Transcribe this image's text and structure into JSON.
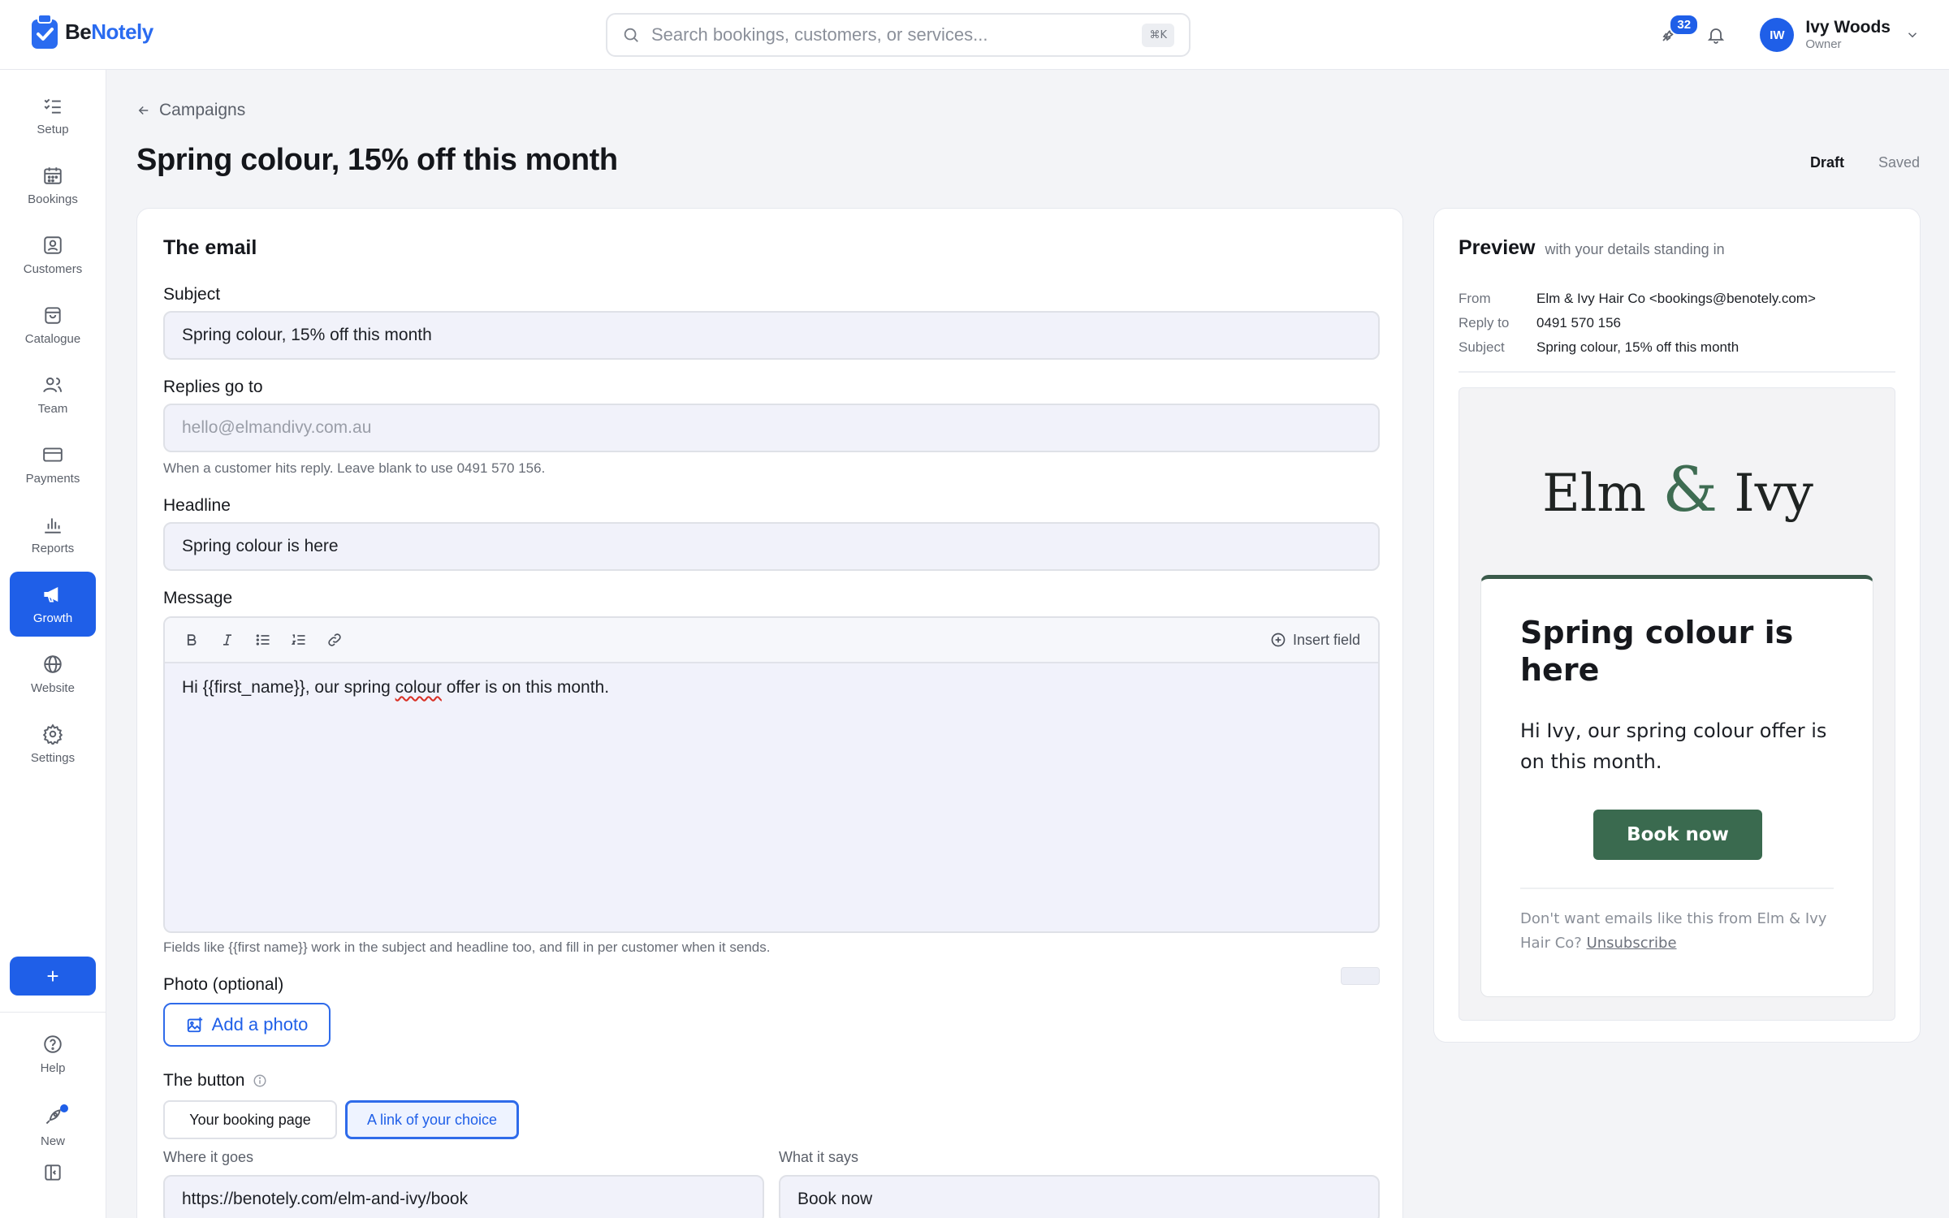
{
  "brand": {
    "name_a": "Be",
    "name_b": "Notely"
  },
  "search": {
    "placeholder": "Search bookings, customers, or services...",
    "shortcut": "⌘K"
  },
  "topbar": {
    "notifications_count": "32"
  },
  "user": {
    "initials": "IW",
    "name": "Ivy Woods",
    "role": "Owner"
  },
  "sidebar": {
    "items": [
      {
        "label": "Setup",
        "icon": "checklist-icon"
      },
      {
        "label": "Bookings",
        "icon": "calendar-icon"
      },
      {
        "label": "Customers",
        "icon": "contact-card-icon"
      },
      {
        "label": "Catalogue",
        "icon": "shopping-bag-icon"
      },
      {
        "label": "Team",
        "icon": "users-icon"
      },
      {
        "label": "Payments",
        "icon": "credit-card-icon"
      },
      {
        "label": "Reports",
        "icon": "bar-chart-icon"
      },
      {
        "label": "Growth",
        "icon": "megaphone-icon",
        "active": true
      },
      {
        "label": "Website",
        "icon": "globe-icon"
      },
      {
        "label": "Settings",
        "icon": "gear-icon"
      }
    ],
    "add_label": "+",
    "help_label": "Help",
    "new_label": "New"
  },
  "page": {
    "back_label": "Campaigns",
    "title": "Spring colour, 15% off this month",
    "status_draft": "Draft",
    "status_saved": "Saved"
  },
  "form": {
    "section_title": "The email",
    "subject_label": "Subject",
    "subject_value": "Spring colour, 15% off this month",
    "replies_label": "Replies go to",
    "replies_placeholder": "hello@elmandivy.com.au",
    "replies_hint": "When a customer hits reply. Leave blank to use 0491 570 156.",
    "headline_label": "Headline",
    "headline_value": "Spring colour is here",
    "message_label": "Message",
    "insert_field_label": "Insert field",
    "message_pre": "Hi {{first_name}}, our spring ",
    "message_misspelled": "colour",
    "message_post": " offer is on this month.",
    "fields_hint": "Fields like {{first name}} work in the subject and headline too, and fill in per customer when it sends.",
    "photo_label": "Photo (optional)",
    "photo_button": "Add a photo",
    "button_label": "The button",
    "button_option_1": "Your booking page",
    "button_option_2": "A link of your choice",
    "where_label": "Where it goes",
    "where_value": "https://benotely.com/elm-and-ivy/book",
    "says_label": "What it says",
    "says_value": "Book now"
  },
  "preview": {
    "title": "Preview",
    "subtitle": "with your details standing in",
    "from_key": "From",
    "from_value": "Elm & Ivy Hair Co <bookings@benotely.com>",
    "reply_key": "Reply to",
    "reply_value": "0491 570 156",
    "subject_key": "Subject",
    "subject_value": "Spring colour, 15% off this month",
    "logo_left": "Elm",
    "logo_amp": "&",
    "logo_right": "Ivy",
    "headline": "Spring colour is here",
    "body": "Hi Ivy, our spring colour offer is on this month.",
    "button": "Book now",
    "footer_text": "Don't want emails like this from Elm & Ivy Hair Co?",
    "unsubscribe": "Unsubscribe"
  },
  "colors": {
    "accent": "#1f5fe8",
    "email_green": "#3a6a4f"
  }
}
